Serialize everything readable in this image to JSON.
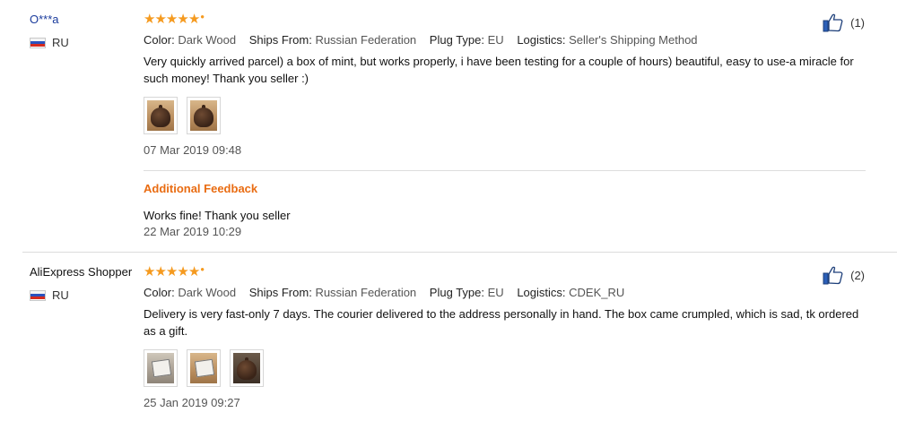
{
  "reviews": [
    {
      "buyer": "O***a",
      "country": "RU",
      "rating": 5,
      "attributes": [
        {
          "key": "Color:",
          "value": "Dark Wood"
        },
        {
          "key": "Ships From:",
          "value": "Russian Federation"
        },
        {
          "key": "Plug Type:",
          "value": "EU"
        },
        {
          "key": "Logistics:",
          "value": "Seller's Shipping Method"
        }
      ],
      "text": "Very quickly arrived parcel) a box of mint, but works properly, i have been testing for a couple of hours) beautiful, easy to use-a miracle for such money! Thank you seller :)",
      "date": "07 Mar 2019 09:48",
      "useful_count": "(1)",
      "additional": {
        "title": "Additional Feedback",
        "text": "Works fine! Thank you seller",
        "date": "22 Mar 2019 10:29"
      }
    },
    {
      "buyer": "AliExpress Shopper",
      "country": "RU",
      "rating": 5,
      "attributes": [
        {
          "key": "Color:",
          "value": "Dark Wood"
        },
        {
          "key": "Ships From:",
          "value": "Russian Federation"
        },
        {
          "key": "Plug Type:",
          "value": "EU"
        },
        {
          "key": "Logistics:",
          "value": "CDEK_RU"
        }
      ],
      "text": "Delivery is very fast-only 7 days. The courier delivered to the address personally in hand. The box came crumpled, which is sad, tk ordered as a gift.",
      "date": "25 Jan 2019 09:27",
      "useful_count": "(2)"
    }
  ],
  "colors": {
    "star": "#f59a1f",
    "additional_title": "#e96c12",
    "buyer_link": "#1a3b9c"
  },
  "icons": {
    "rating": "star-icon",
    "useful": "thumbs-up-icon",
    "country": "russia-flag-icon"
  }
}
